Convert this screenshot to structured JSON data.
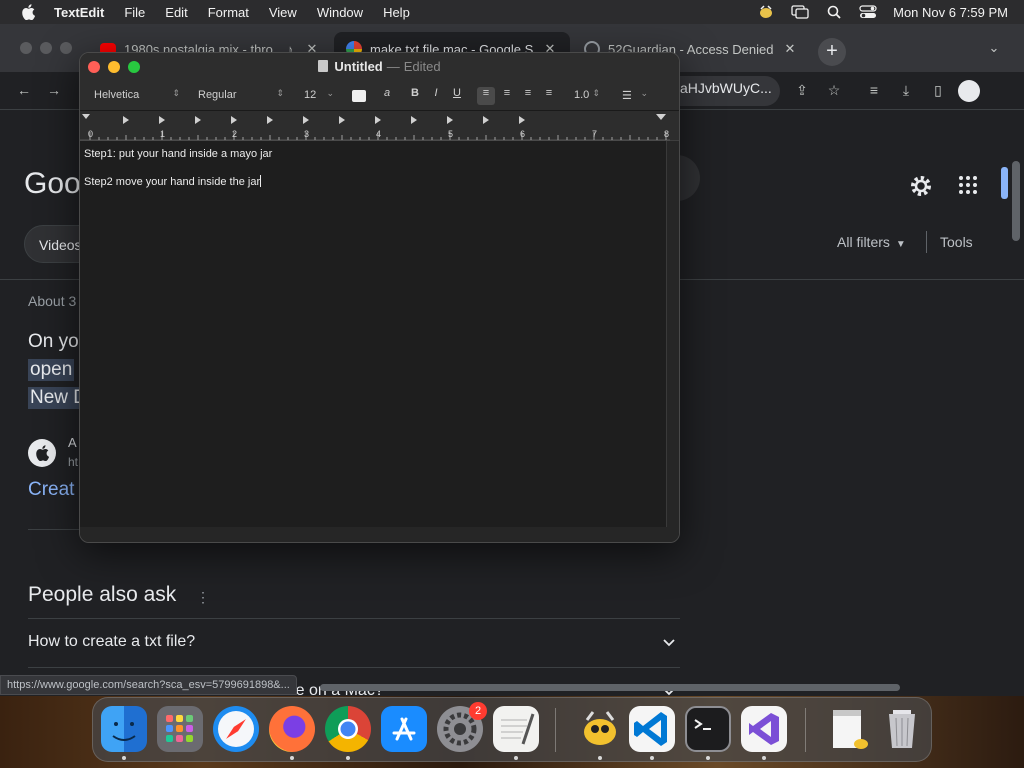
{
  "menubar": {
    "app_name": "TextEdit",
    "items": [
      "File",
      "Edit",
      "Format",
      "View",
      "Window",
      "Help"
    ],
    "clock": "Mon Nov 6  7:59 PM"
  },
  "browser": {
    "tabs": [
      {
        "title": "1980s nostalgia mix - thro",
        "icon": "youtube-icon"
      },
      {
        "title": "make txt file mac - Google S",
        "icon": "google-icon"
      },
      {
        "title": "52Guardian - Access Denied",
        "icon": "globe-icon"
      }
    ],
    "address_visible": "aHJvbWUyC...",
    "status_url": "https://www.google.com/search?sca_esv=5799691898&..."
  },
  "google": {
    "logo_partial": "Goo",
    "videos_chip": "Videos",
    "all_filters": "All filters",
    "tools": "Tools",
    "about_partial": "About 3",
    "answer_line1": "On yo",
    "answer_line2": "open",
    "answer_line3": "New D",
    "source_name_partial": "A",
    "source_url_partial": "ht",
    "result_link_partial": "Creat",
    "people_also_ask": "People also ask",
    "questions": [
      "How to create a txt file?",
      "What is the shortcut to create a text file on a Mac?"
    ]
  },
  "textedit": {
    "title": "Untitled",
    "separator": "—",
    "status": "Edited",
    "font_family": "Helvetica",
    "font_style": "Regular",
    "font_size": "12",
    "line_spacing": "1.0",
    "ruler_numbers": [
      "0",
      "1",
      "2",
      "3",
      "4",
      "5",
      "6",
      "7",
      "8"
    ],
    "lines": [
      "Step1: put your hand inside a mayo jar",
      "Step2 move your hand inside the jar"
    ]
  },
  "dock": {
    "apps": [
      "Finder",
      "Launchpad",
      "Safari",
      "Firefox",
      "Chrome",
      "App Store",
      "System Settings",
      "TextEdit",
      "Cyberduck",
      "Visual Studio Code",
      "Terminal",
      "Visual Studio",
      "Preview",
      "Trash"
    ],
    "settings_badge": "2"
  },
  "colors": {
    "accent_blue": "#8ab4f8",
    "selection": "#394457",
    "close": "#ff5f57",
    "minimize": "#febc2e",
    "zoom": "#28c840"
  }
}
